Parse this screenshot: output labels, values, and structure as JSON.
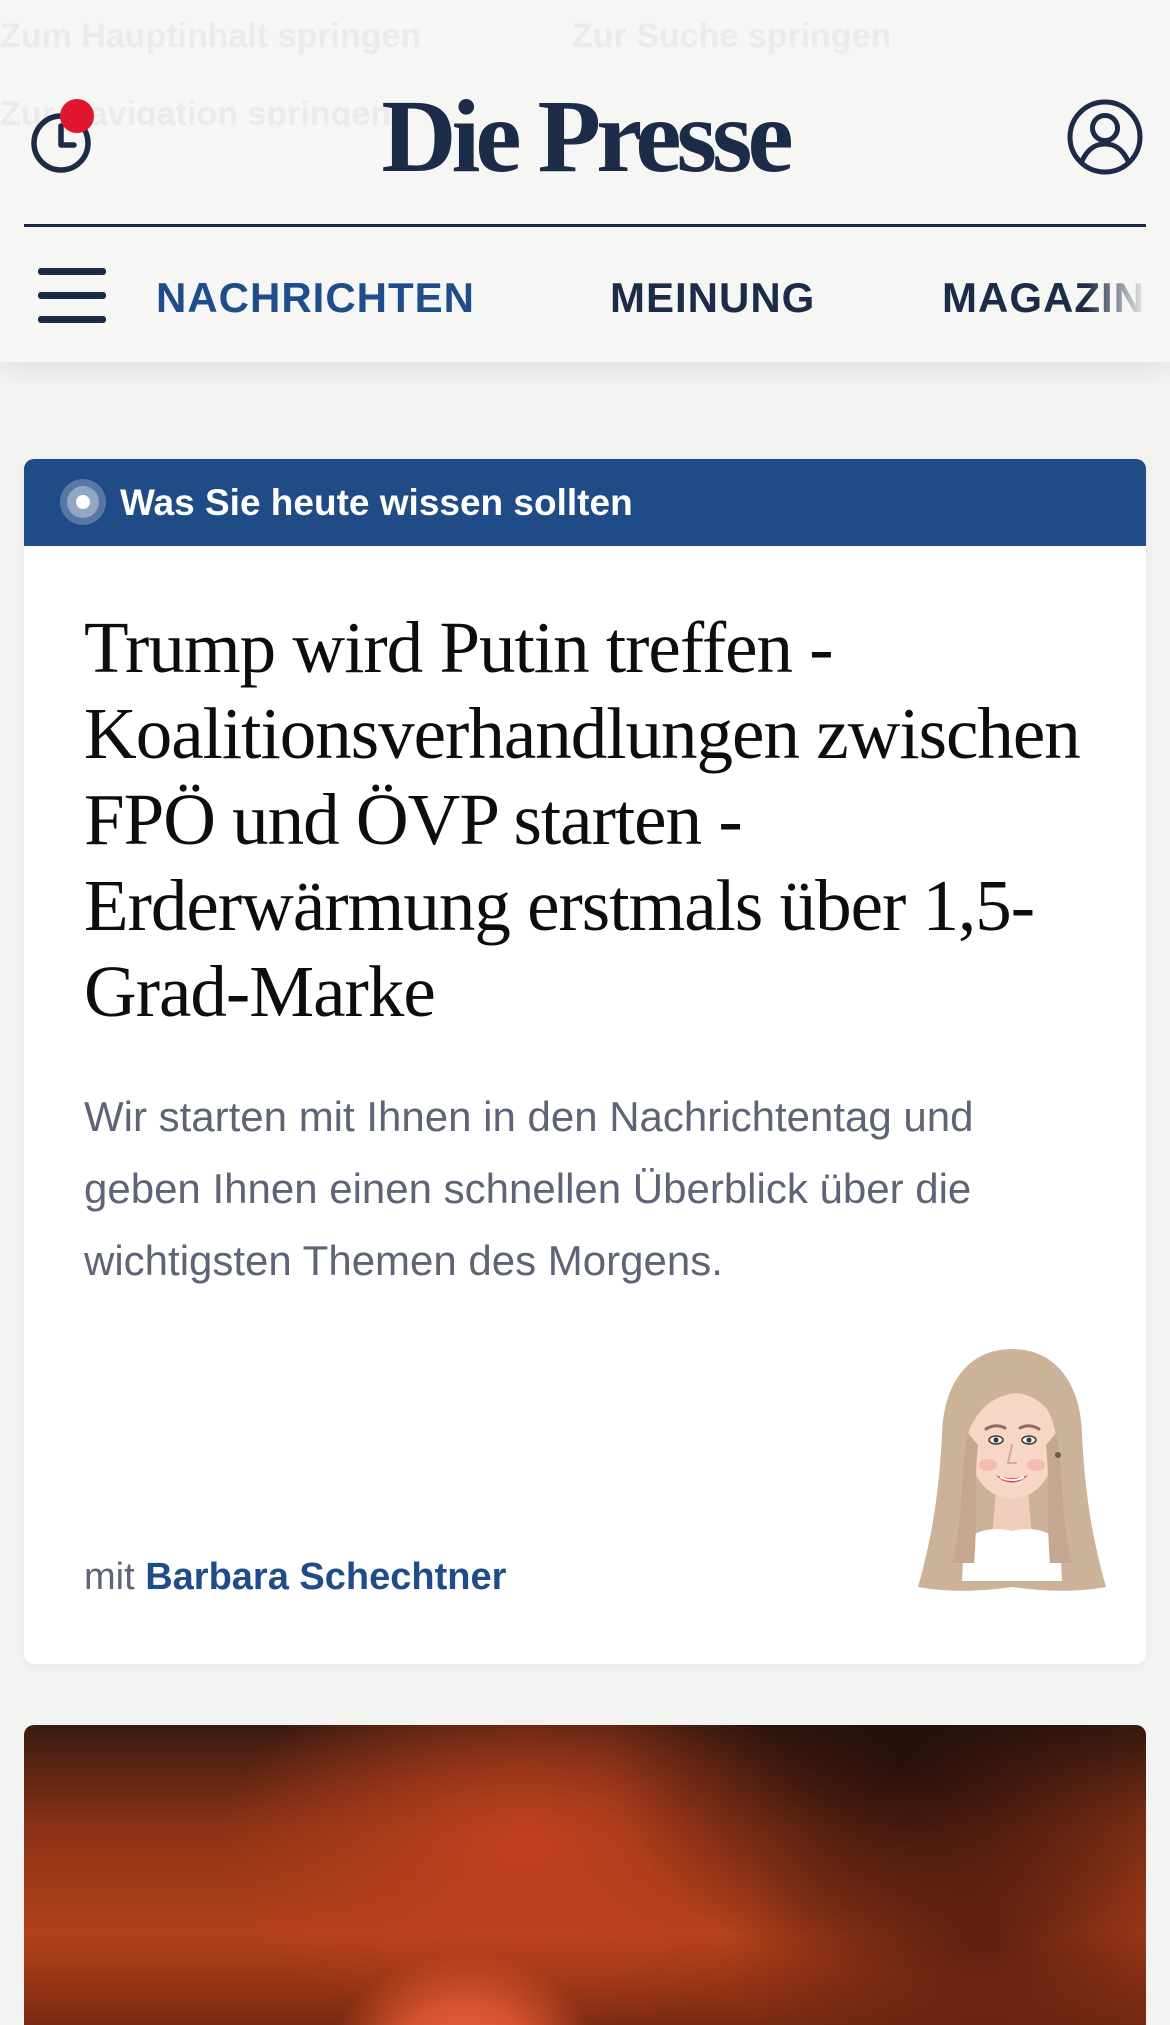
{
  "skip_links": [
    "Zum Hauptinhalt springen",
    "Zur Suche springen",
    "Zur Navigation springen"
  ],
  "header": {
    "logo": "Die Presse",
    "history_icon": "clock-history-icon",
    "notification_color": "#e0162f",
    "account_icon": "user-account-icon",
    "menu_icon": "hamburger-menu-icon"
  },
  "nav": {
    "items": [
      {
        "label": "NACHRICHTEN",
        "active": true
      },
      {
        "label": "MEINUNG",
        "active": false
      },
      {
        "label": "MAGAZIN",
        "active": false
      }
    ]
  },
  "briefing": {
    "label": "Was Sie heute wissen sollten",
    "live_icon": "live-dot-icon",
    "title": "Trump wird Putin treffen - Koalitionsverhandlungen zwischen FPÖ und ÖVP starten - Erderwärmung erstmals über 1,5-Grad-Marke",
    "lead": "Wir starten mit Ihnen in den Nachrichtentag und geben Ihnen einen schnellen Überblick über die wichtigsten Themen des Morgens.",
    "byline_prefix": "mit",
    "author": "Barbara Schechtner"
  },
  "colors": {
    "brand_navy": "#1c2b47",
    "accent_blue": "#1f4c8a",
    "band_blue": "#1f4b86",
    "page_background": "#f3f3f1",
    "lead_text": "#5e6476"
  }
}
